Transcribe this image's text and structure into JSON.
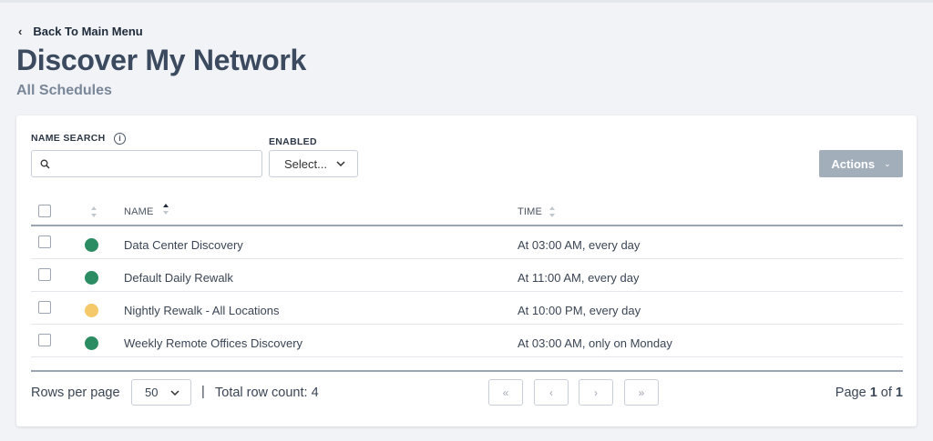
{
  "nav": {
    "back_label": "Back To Main Menu",
    "back_icon": "chevron-left-icon"
  },
  "header": {
    "title": "Discover My Network",
    "subtitle": "All Schedules"
  },
  "filters": {
    "name_search_label": "NAME SEARCH",
    "name_search_value": "",
    "enabled_label": "ENABLED",
    "enabled_value": "Select..."
  },
  "toolbar": {
    "actions_label": "Actions"
  },
  "table": {
    "columns": {
      "name": "NAME",
      "time": "TIME"
    },
    "rows": [
      {
        "name": "Data Center Discovery",
        "time": "At 03:00 AM, every day",
        "status_color": "#2b8c63"
      },
      {
        "name": "Default Daily Rewalk",
        "time": "At 11:00 AM, every day",
        "status_color": "#2b8c63"
      },
      {
        "name": "Nightly Rewalk - All Locations",
        "time": "At 10:00 PM, every day",
        "status_color": "#f5c96a"
      },
      {
        "name": "Weekly Remote Offices Discovery",
        "time": "At 03:00 AM, only on Monday",
        "status_color": "#2b8c63"
      }
    ]
  },
  "pagination": {
    "rows_per_page_label": "Rows per page",
    "rows_per_page_value": "50",
    "separator": "|",
    "total_label": "Total row count: 4",
    "page_word": "Page",
    "current_page": "1",
    "of_word": "of",
    "total_pages": "1"
  },
  "colors": {
    "accent_button": "#a3aebb",
    "title": "#3b4a5e",
    "background": "#f1f3f7"
  }
}
